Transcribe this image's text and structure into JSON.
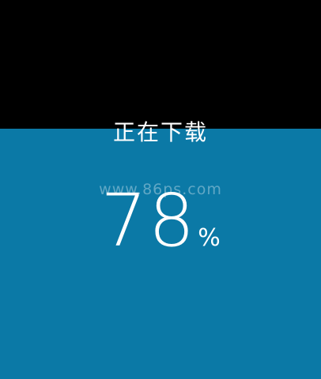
{
  "download": {
    "status_text": "正在下载",
    "watermark": "www.86ps.com",
    "progress_value": "78",
    "progress_unit": "%",
    "progress_fraction": 0.66
  },
  "colors": {
    "background": "#000000",
    "fill": "#0b79a6",
    "text": "#ffffff"
  }
}
